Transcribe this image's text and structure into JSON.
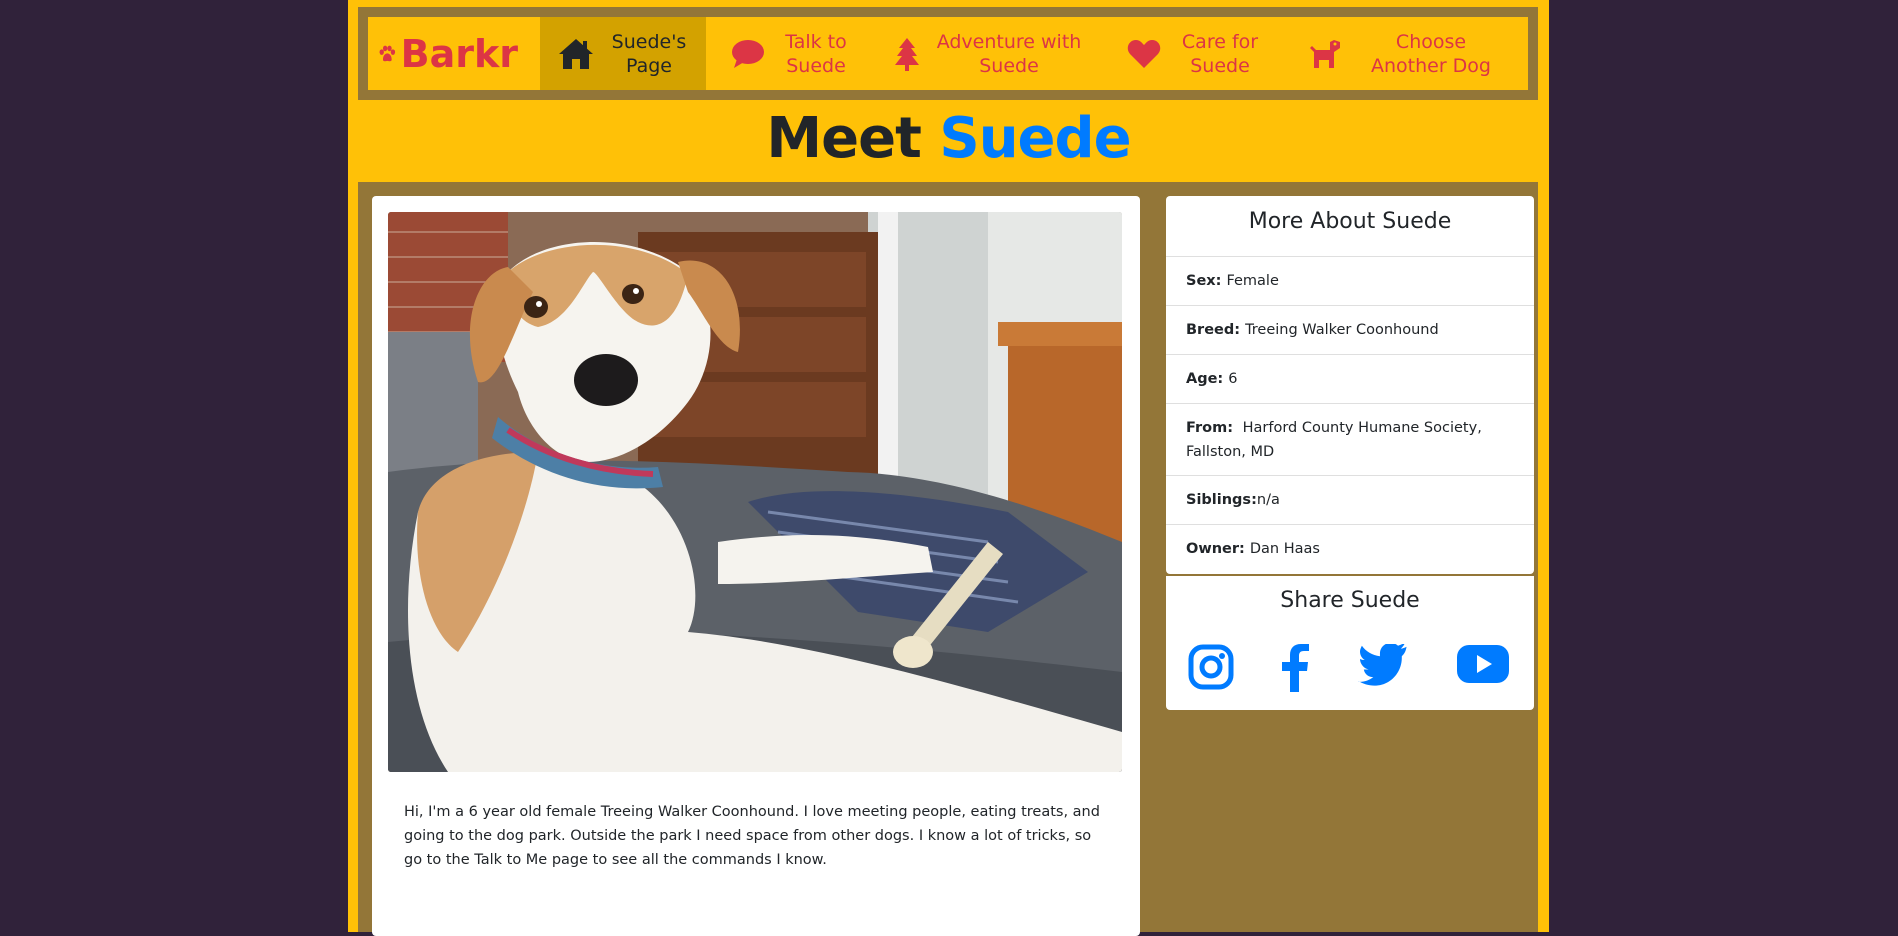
{
  "brand": {
    "name": "Barkr",
    "icon": "paw-icon"
  },
  "nav": {
    "items": [
      {
        "label": "Suede's Page",
        "icon": "home-icon",
        "active": true
      },
      {
        "label": "Talk to Suede",
        "icon": "speech-bubble-icon"
      },
      {
        "label": "Adventure with Suede",
        "icon": "tree-icon"
      },
      {
        "label": "Care for Suede",
        "icon": "heart-icon"
      },
      {
        "label": "Choose Another Dog",
        "icon": "dog-icon"
      }
    ]
  },
  "header": {
    "prefix": "Meet",
    "name": "Suede"
  },
  "photo": {
    "alt": "Suede the dog"
  },
  "bio": "Hi, I'm a 6 year old female Treeing Walker Coonhound. I love meeting people, eating treats, and going to the dog park. Outside the park I need space from other dogs. I know a lot of tricks, so go to the Talk to Me page to see all the commands I know.",
  "about": {
    "title": "More About Suede",
    "rows": [
      {
        "label": "Sex:",
        "value": "Female"
      },
      {
        "label": "Breed:",
        "value": "Treeing Walker Coonhound"
      },
      {
        "label": "Age:",
        "value": "6"
      },
      {
        "label": "From:",
        "value": "Harford County Humane Society, Fallston, MD"
      },
      {
        "label": "Siblings:",
        "value": "n/a"
      },
      {
        "label": "Owner:",
        "value": "Dan Haas"
      }
    ]
  },
  "share": {
    "title": "Share Suede",
    "icons": [
      "instagram-icon",
      "facebook-icon",
      "twitter-icon",
      "youtube-icon"
    ]
  },
  "colors": {
    "page_bg": "#30223a",
    "accent_yellow": "#ffc107",
    "frame_brown": "#937638",
    "nav_red": "#dc3545",
    "link_blue": "#007bff",
    "active_nav": "#d3a200"
  }
}
